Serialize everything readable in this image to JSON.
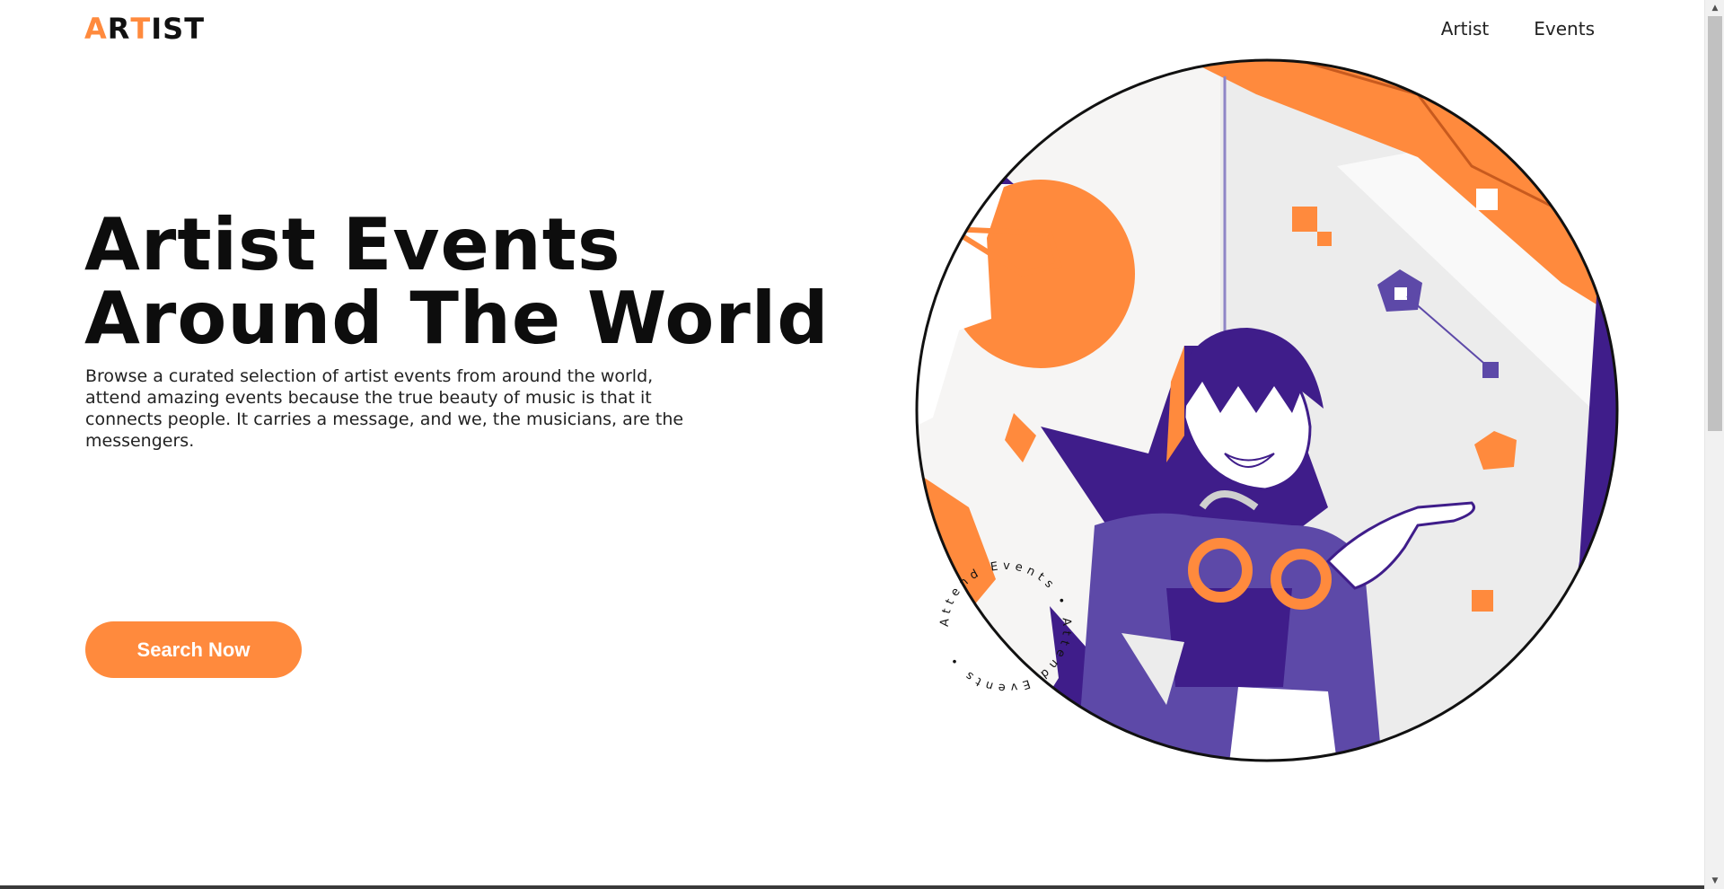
{
  "header": {
    "logo": {
      "prefix": "A",
      "accent": "R",
      "middle": "T",
      "suffix": "IST"
    },
    "nav": [
      {
        "label": "Artist"
      },
      {
        "label": "Events"
      }
    ]
  },
  "hero": {
    "title_line1": "Artist Events",
    "title_line2": "Around The World",
    "description": "Browse a curated selection of artist events from around the world, attend amazing events because the true beauty of music is that it connects people. It carries a message, and we, the musicians, are the messengers.",
    "cta_label": "Search Now"
  },
  "badge": {
    "circular_text": "Attend Events • Attend Events • "
  },
  "colors": {
    "accent": "#ff8a3d",
    "purple": "#3f1d8a",
    "light_purple": "#5d49a8",
    "text": "#0d0d0d"
  }
}
